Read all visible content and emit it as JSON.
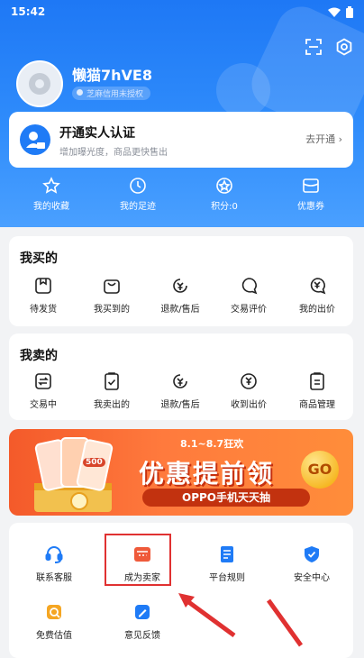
{
  "status_bar": {
    "time": "15:42"
  },
  "profile": {
    "username": "懒猫7hVE8",
    "badge": "芝麻信用未授权"
  },
  "verify_card": {
    "title": "开通实人认证",
    "subtitle": "增加曝光度，商品更快售出",
    "action": "去开通"
  },
  "quick_bar": [
    {
      "label": "我的收藏",
      "icon": "star-icon"
    },
    {
      "label": "我的足迹",
      "icon": "clock-icon"
    },
    {
      "label": "积分:0",
      "icon": "coin-icon"
    },
    {
      "label": "优惠券",
      "icon": "coupon-icon"
    }
  ],
  "buy_section": {
    "title": "我买的",
    "items": [
      {
        "label": "待发货",
        "icon": "box-icon"
      },
      {
        "label": "我买到的",
        "icon": "bag-icon"
      },
      {
        "label": "退款/售后",
        "icon": "refund-icon"
      },
      {
        "label": "交易评价",
        "icon": "comment-icon"
      },
      {
        "label": "我的出价",
        "icon": "bid-icon"
      }
    ]
  },
  "sell_section": {
    "title": "我卖的",
    "items": [
      {
        "label": "交易中",
        "icon": "trade-icon"
      },
      {
        "label": "我卖出的",
        "icon": "sold-icon"
      },
      {
        "label": "退款/售后",
        "icon": "refund-icon"
      },
      {
        "label": "收到出价",
        "icon": "received-bid-icon"
      },
      {
        "label": "商品管理",
        "icon": "manage-icon"
      }
    ]
  },
  "banner": {
    "date": "8.1~8.7狂欢",
    "title": "优惠提前领",
    "pill": "OPPO手机天天抽",
    "go": "GO",
    "phone_badge": "500"
  },
  "service_section": {
    "items": [
      {
        "label": "联系客服",
        "icon": "headset-icon",
        "color": "#1f7bf6"
      },
      {
        "label": "成为卖家",
        "icon": "seller-icon",
        "color": "#ef5a3a"
      },
      {
        "label": "平台规则",
        "icon": "document-icon",
        "color": "#1f7bf6"
      },
      {
        "label": "安全中心",
        "icon": "shield-icon",
        "color": "#1f7bf6"
      },
      {
        "label": "免费估值",
        "icon": "valuation-icon",
        "color": "#f5a623"
      },
      {
        "label": "意见反馈",
        "icon": "feedback-icon",
        "color": "#1f7bf6"
      }
    ]
  },
  "colors": {
    "accent": "#1f7bf6",
    "highlight": "#e03131",
    "banner": "#ff7a3d"
  }
}
